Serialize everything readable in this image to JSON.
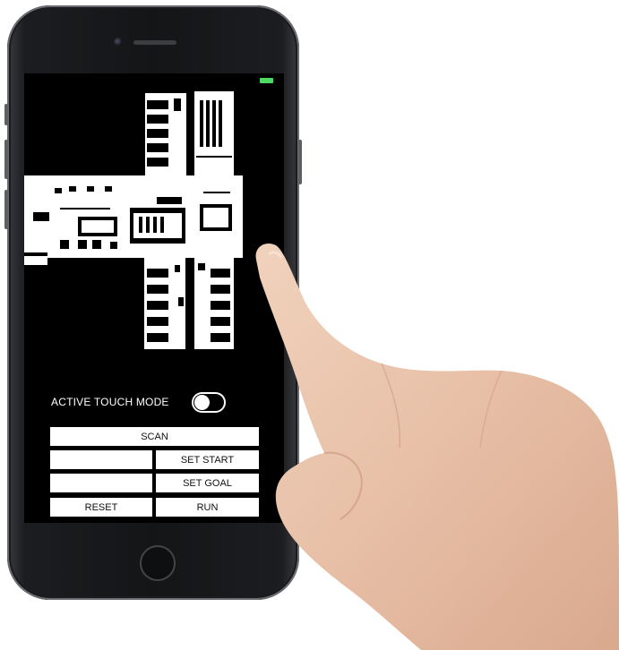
{
  "toggle": {
    "label": "ACTIVE TOUCH MODE",
    "state": "off"
  },
  "buttons": {
    "scan": "SCAN",
    "set_start": "SET START",
    "set_goal": "SET GOAL",
    "reset": "RESET",
    "run": "RUN",
    "blank_1": "",
    "blank_2": ""
  },
  "colors": {
    "screen_bg": "#000000",
    "battery": "#4cd964",
    "button_bg": "#ffffff"
  }
}
